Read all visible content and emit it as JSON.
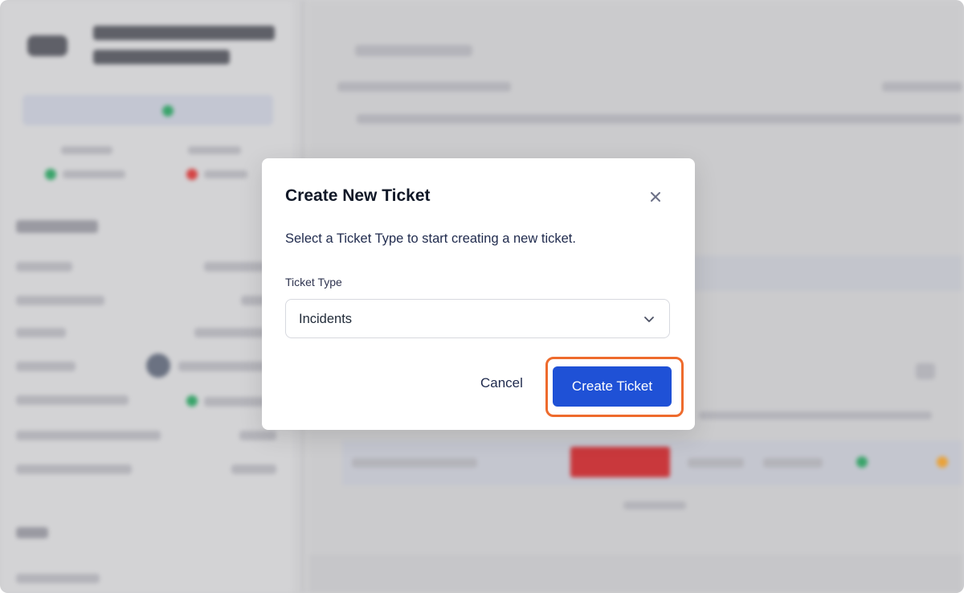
{
  "modal": {
    "title": "Create New Ticket",
    "description": "Select a Ticket Type to start creating a new ticket.",
    "ticket_type_label": "Ticket Type",
    "ticket_type_value": "Incidents",
    "cancel_label": "Cancel",
    "submit_label": "Create Ticket",
    "close_icon": "close-icon",
    "chevron_icon": "chevron-down-icon"
  },
  "colors": {
    "primary": "#1f51d6",
    "highlight": "#ee6b2d",
    "overlay": "#cfcfd1"
  }
}
